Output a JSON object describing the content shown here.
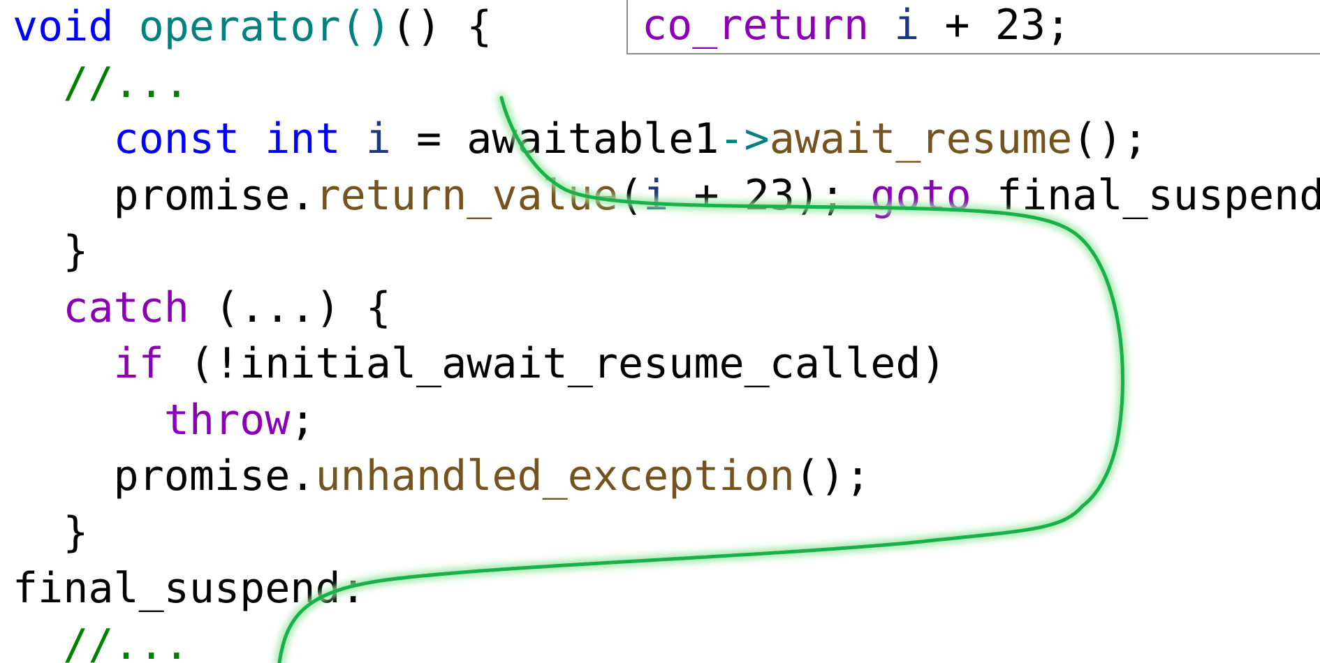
{
  "colors": {
    "keyword": "#0000ff",
    "function": "#00807f",
    "control": "#8b00b4",
    "comment": "#008000",
    "member": "#74531f",
    "variable": "#1f377f",
    "arrow_op": "#00807f",
    "default": "#000000",
    "flow_line": "#18b04a"
  },
  "callout": {
    "tokens": [
      {
        "text": "co_return",
        "style": "control"
      },
      {
        "text": " ",
        "style": "default"
      },
      {
        "text": "i",
        "style": "variable"
      },
      {
        "text": " + 23;",
        "style": "default"
      }
    ]
  },
  "code": {
    "lines": [
      [
        {
          "text": "void",
          "style": "keyword"
        },
        {
          "text": " ",
          "style": "default"
        },
        {
          "text": "operator()",
          "style": "function"
        },
        {
          "text": "() {",
          "style": "default"
        }
      ],
      [
        {
          "text": "  ",
          "style": "default"
        },
        {
          "text": "//...",
          "style": "comment"
        }
      ],
      [
        {
          "text": "    ",
          "style": "default"
        },
        {
          "text": "const",
          "style": "keyword"
        },
        {
          "text": " ",
          "style": "default"
        },
        {
          "text": "int",
          "style": "keyword"
        },
        {
          "text": " ",
          "style": "default"
        },
        {
          "text": "i",
          "style": "variable"
        },
        {
          "text": " = awaitable1",
          "style": "default"
        },
        {
          "text": "->",
          "style": "arrow_op"
        },
        {
          "text": "await_resume",
          "style": "member"
        },
        {
          "text": "();",
          "style": "default"
        }
      ],
      [
        {
          "text": "    promise.",
          "style": "default"
        },
        {
          "text": "return_value",
          "style": "member"
        },
        {
          "text": "(",
          "style": "default"
        },
        {
          "text": "i",
          "style": "variable"
        },
        {
          "text": " + 23); ",
          "style": "default"
        },
        {
          "text": "goto",
          "style": "control"
        },
        {
          "text": " final_suspend;",
          "style": "default"
        }
      ],
      [
        {
          "text": "  }",
          "style": "default"
        }
      ],
      [
        {
          "text": "  ",
          "style": "default"
        },
        {
          "text": "catch",
          "style": "control"
        },
        {
          "text": " (...) {",
          "style": "default"
        }
      ],
      [
        {
          "text": "    ",
          "style": "default"
        },
        {
          "text": "if",
          "style": "control"
        },
        {
          "text": " (!initial_await_resume_called)",
          "style": "default"
        }
      ],
      [
        {
          "text": "      ",
          "style": "default"
        },
        {
          "text": "throw",
          "style": "control"
        },
        {
          "text": ";",
          "style": "default"
        }
      ],
      [
        {
          "text": "    promise.",
          "style": "default"
        },
        {
          "text": "unhandled_exception",
          "style": "member"
        },
        {
          "text": "();",
          "style": "default"
        }
      ],
      [
        {
          "text": "  }",
          "style": "default"
        }
      ],
      [
        {
          "text": "final_suspend:",
          "style": "default"
        }
      ],
      [
        {
          "text": "  ",
          "style": "default"
        },
        {
          "text": "//...",
          "style": "comment"
        }
      ]
    ]
  }
}
